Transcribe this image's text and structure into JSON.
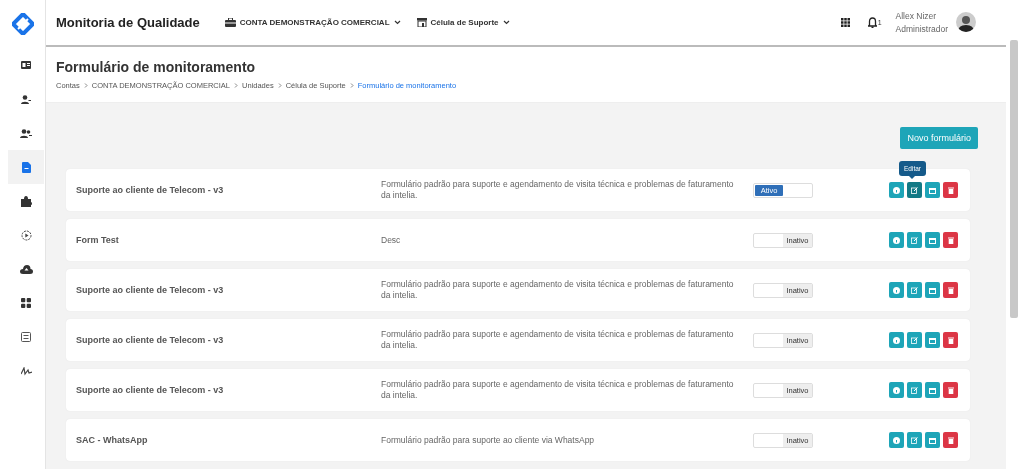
{
  "sidebar": {
    "items": [
      {
        "kind": "card",
        "selected": false
      },
      {
        "kind": "user",
        "selected": false
      },
      {
        "kind": "users",
        "selected": false
      },
      {
        "kind": "file",
        "selected": true
      },
      {
        "kind": "puzzle",
        "selected": false
      },
      {
        "kind": "play",
        "selected": false
      },
      {
        "kind": "cloud",
        "selected": false
      },
      {
        "kind": "grid",
        "selected": false
      },
      {
        "kind": "list",
        "selected": false
      },
      {
        "kind": "signature",
        "selected": false
      }
    ]
  },
  "header": {
    "title": "Monitoria de Qualidade",
    "account": "CONTA DEMONSTRAÇÃO COMERCIAL",
    "unit": "Célula de Suporte",
    "notifications": "1",
    "user_name": "Allex Nizer",
    "user_role": "Administrador"
  },
  "page": {
    "title": "Formulário de monitoramento",
    "breadcrumbs": [
      {
        "label": "Contas",
        "current": false
      },
      {
        "label": "CONTA DEMONSTRAÇÃO COMERCIAL",
        "current": false
      },
      {
        "label": "Unidades",
        "current": false
      },
      {
        "label": "Célula de Suporte",
        "current": false
      },
      {
        "label": "Formulário de monitoramento",
        "current": true
      }
    ],
    "new_button": "Novo formulário"
  },
  "forms": [
    {
      "name": "Suporte ao cliente de Telecom - v3",
      "description": "Formulário padrão para suporte e agendamento de visita técnica e problemas de faturamento da intelia.",
      "active": true,
      "status": "Ativo",
      "tooltip": "Editar"
    },
    {
      "name": "Form Test",
      "description": "Desc",
      "active": false,
      "status": "Inativo"
    },
    {
      "name": "Suporte ao cliente de Telecom - v3",
      "description": "Formulário padrão para suporte e agendamento de visita técnica e problemas de faturamento da intelia.",
      "active": false,
      "status": "Inativo"
    },
    {
      "name": "Suporte ao cliente de Telecom - v3",
      "description": "Formulário padrão para suporte e agendamento de visita técnica e problemas de faturamento da intelia.",
      "active": false,
      "status": "Inativo"
    },
    {
      "name": "Suporte ao cliente de Telecom - v3",
      "description": "Formulário padrão para suporte e agendamento de visita técnica e problemas de faturamento da intelia.",
      "active": false,
      "status": "Inativo"
    },
    {
      "name": "SAC - WhatsApp",
      "description": "Formulário padrão para suporte ao cliente via WhatsApp",
      "active": false,
      "status": "Inativo"
    }
  ]
}
